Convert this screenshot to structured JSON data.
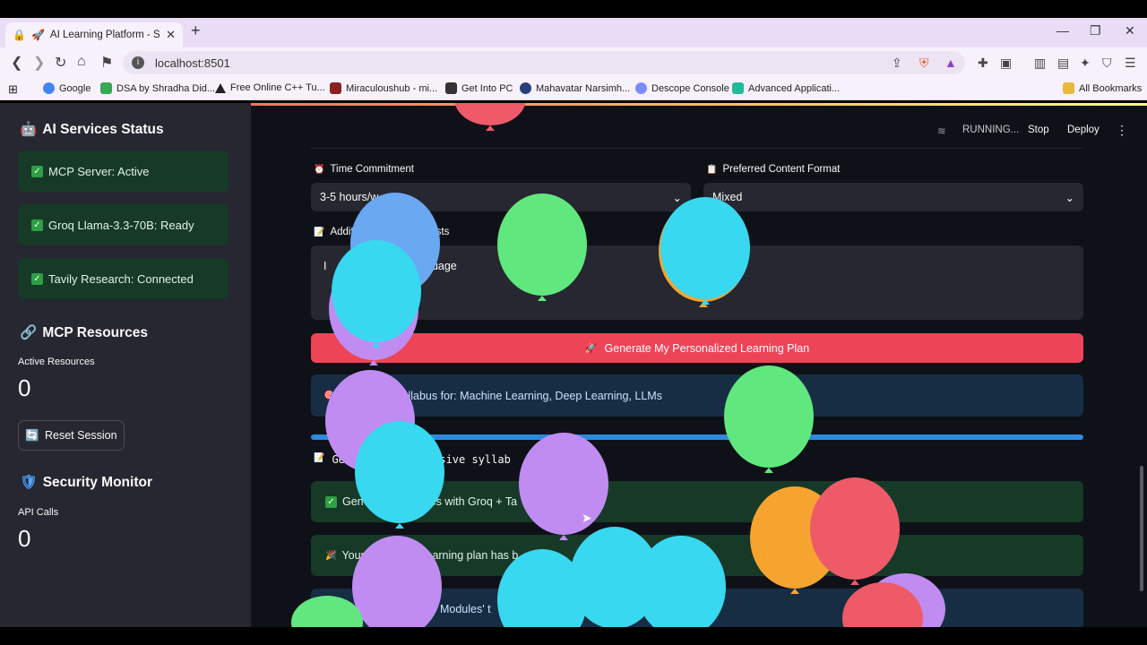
{
  "browser": {
    "tab_title": "AI Learning Platform - Secur",
    "url": "localhost:8501",
    "bookmarks": [
      "Google",
      "DSA by Shradha Did...",
      "Free Online C++ Tu...",
      "Miraculoushub - mi...",
      "Get Into PC",
      "Mahavatar Narsimh...",
      "Descope Console",
      "Advanced Applicati...",
      "All Bookmarks"
    ],
    "bookmark_colors": [
      "#4285f4",
      "#3aa757",
      "#222222",
      "#8a2222",
      "#333333",
      "#27407a",
      "#7a8cff",
      "#22bb99",
      "#e8b93a"
    ]
  },
  "header": {
    "running": "RUNNING...",
    "stop": "Stop",
    "deploy": "Deploy",
    "menu_icon": "⋮"
  },
  "sidebar": {
    "services_title": "AI Services Status",
    "services_icon": "🤖",
    "services": [
      "MCP Server: Active",
      "Groq Llama-3.3-70B: Ready",
      "Tavily Research: Connected"
    ],
    "resources_title": "MCP Resources",
    "resources_icon": "🔗",
    "active_resources_label": "Active Resources",
    "active_resources_value": "0",
    "reset_label": "Reset Session",
    "reset_icon": "🔄",
    "security_title": "Security Monitor",
    "security_icon": "🛡",
    "api_calls_label": "API Calls",
    "api_calls_value": "0"
  },
  "form": {
    "time_label": "Time Commitment",
    "time_icon": "⏰",
    "time_value": "3-5 hours/w",
    "format_label": "Preferred Content Format",
    "format_icon": "📋",
    "format_value": "Mixed",
    "requests_label_a": "Additi",
    "requests_label_b": "ic Requests",
    "requests_icon": "📝",
    "textarea_a": "I",
    "textarea_b": "guage",
    "generate_label": "Generate My Personalized Learning Plan",
    "generate_icon": "🚀"
  },
  "output": {
    "info_text": "llabus for: Machine Learning, Deep Learning, LLMs",
    "info_icon": "🎯",
    "progress_fraction": 1.0,
    "mono_a": "Ge",
    "mono_b": "ensive syllab",
    "mono_icon": "📝",
    "ok1_a": "Gen",
    "ok1_b": "es with Groq + Ta",
    "ok2_a": "Your",
    "ok2_b": "learning plan has b",
    "ok2_c": "ne",
    "ok2_icon": "🎉",
    "blue_a": "Ch",
    "blue_b": "Modules' t"
  },
  "balloon_colors": [
    "#ef5a68",
    "#60e87f",
    "#38d8f0",
    "#c08cf2",
    "#f6a42f",
    "#6aa8f2"
  ]
}
